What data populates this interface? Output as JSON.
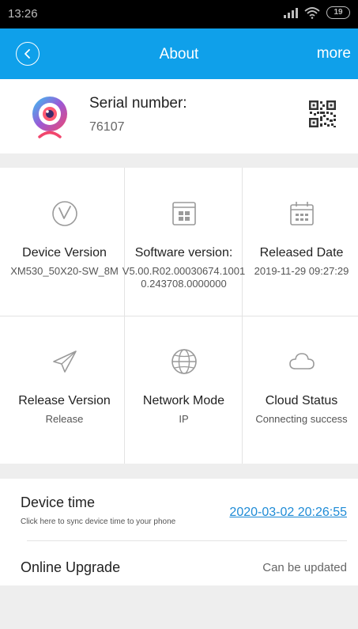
{
  "status_bar": {
    "time": "13:26",
    "battery": "19"
  },
  "nav": {
    "back_icon": "back-circle-icon",
    "title": "About",
    "more_label": "more"
  },
  "device": {
    "serial_label": "Serial number:",
    "serial_value": "76107",
    "logo_icon": "camera-app-logo",
    "qr_icon": "qr-code-icon"
  },
  "info_cells": [
    {
      "icon": "v-circle-icon",
      "label": "Device Version",
      "value": "XM530_50X20-SW_8M"
    },
    {
      "icon": "chip-icon",
      "label": "Software version:",
      "value": "V5.00.R02.00030674.10010.243708.0000000"
    },
    {
      "icon": "calendar-icon",
      "label": "Released Date",
      "value": "2019-11-29 09:27:29"
    },
    {
      "icon": "paper-plane-icon",
      "label": "Release Version",
      "value": "Release"
    },
    {
      "icon": "globe-icon",
      "label": "Network Mode",
      "value": "IP"
    },
    {
      "icon": "cloud-icon",
      "label": "Cloud Status",
      "value": "Connecting success"
    }
  ],
  "device_time": {
    "title": "Device time",
    "hint": "Click here to sync device time to your phone",
    "value": "2020-03-02 20:26:55"
  },
  "upgrade": {
    "title": "Online Upgrade",
    "status": "Can be updated"
  },
  "colors": {
    "nav_bg": "#0fa0ea",
    "link": "#1e8bd6",
    "icon_gray": "#9a9a9a"
  }
}
